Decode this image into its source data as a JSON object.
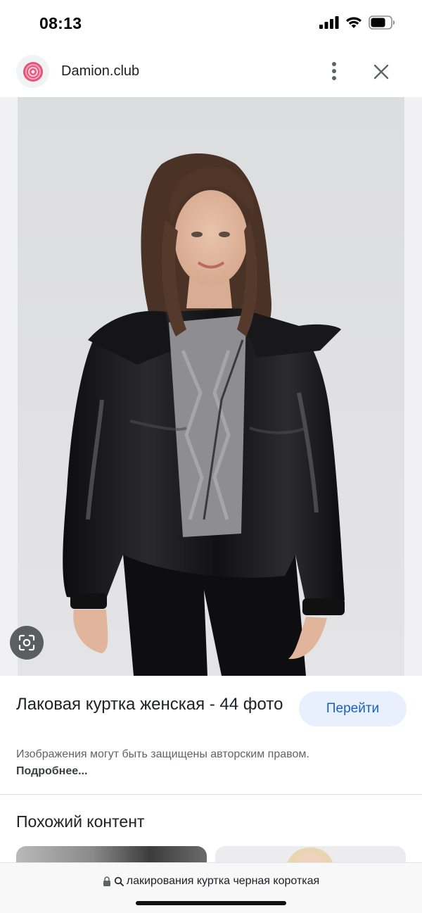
{
  "status_bar": {
    "time": "08:13"
  },
  "header": {
    "site_name": "Damion.club"
  },
  "result": {
    "title": "Лаковая куртка женская - 44 фото",
    "visit_label": "Перейти",
    "copyright_text": "Изображения могут быть защищены авторским правом.",
    "more_link": "Подробнее..."
  },
  "similar": {
    "heading": "Похожий контент"
  },
  "url_bar": {
    "text": "лакирования куртка черная короткая"
  },
  "icons": {
    "signal": "cellular-signal-icon",
    "wifi": "wifi-icon",
    "battery": "battery-icon",
    "favicon": "site-favicon-icon",
    "more": "more-vert-icon",
    "close": "close-icon",
    "lens": "google-lens-icon",
    "lock": "lock-icon",
    "search": "search-icon"
  },
  "colors": {
    "accent": "#1a5fc4",
    "button_bg": "#e8f0fe",
    "favicon": "#e8557a"
  }
}
